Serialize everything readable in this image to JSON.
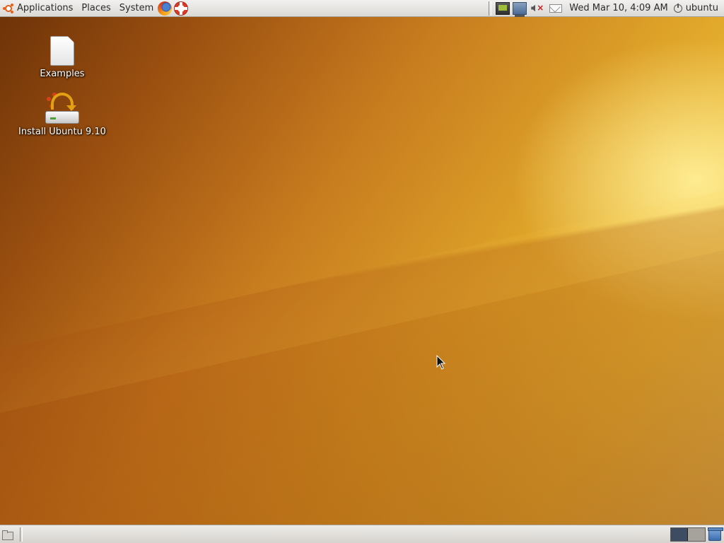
{
  "top_panel": {
    "menus": {
      "applications": "Applications",
      "places": "Places",
      "system": "System"
    },
    "launchers": [
      "firefox-icon",
      "help-icon"
    ],
    "tray_icons": [
      "network-icon",
      "display-icon",
      "volume-muted-icon",
      "mail-icon"
    ],
    "clock": "Wed Mar 10,  4:09 AM",
    "user": "ubuntu"
  },
  "desktop": {
    "icons": [
      {
        "label": "Examples",
        "icon": "document-icon"
      },
      {
        "label": "Install Ubuntu 9.10",
        "icon": "install-icon"
      }
    ]
  },
  "bottom_panel": {
    "workspaces": 2,
    "active_workspace": 1,
    "icons": [
      "show-desktop-icon",
      "trash-icon"
    ]
  },
  "colors": {
    "wallpaper_dark": "#6e3308",
    "wallpaper_mid": "#c67a1e",
    "wallpaper_light": "#f6d760",
    "panel": "#e6e4e0",
    "ubuntu_orange": "#e4621d"
  }
}
